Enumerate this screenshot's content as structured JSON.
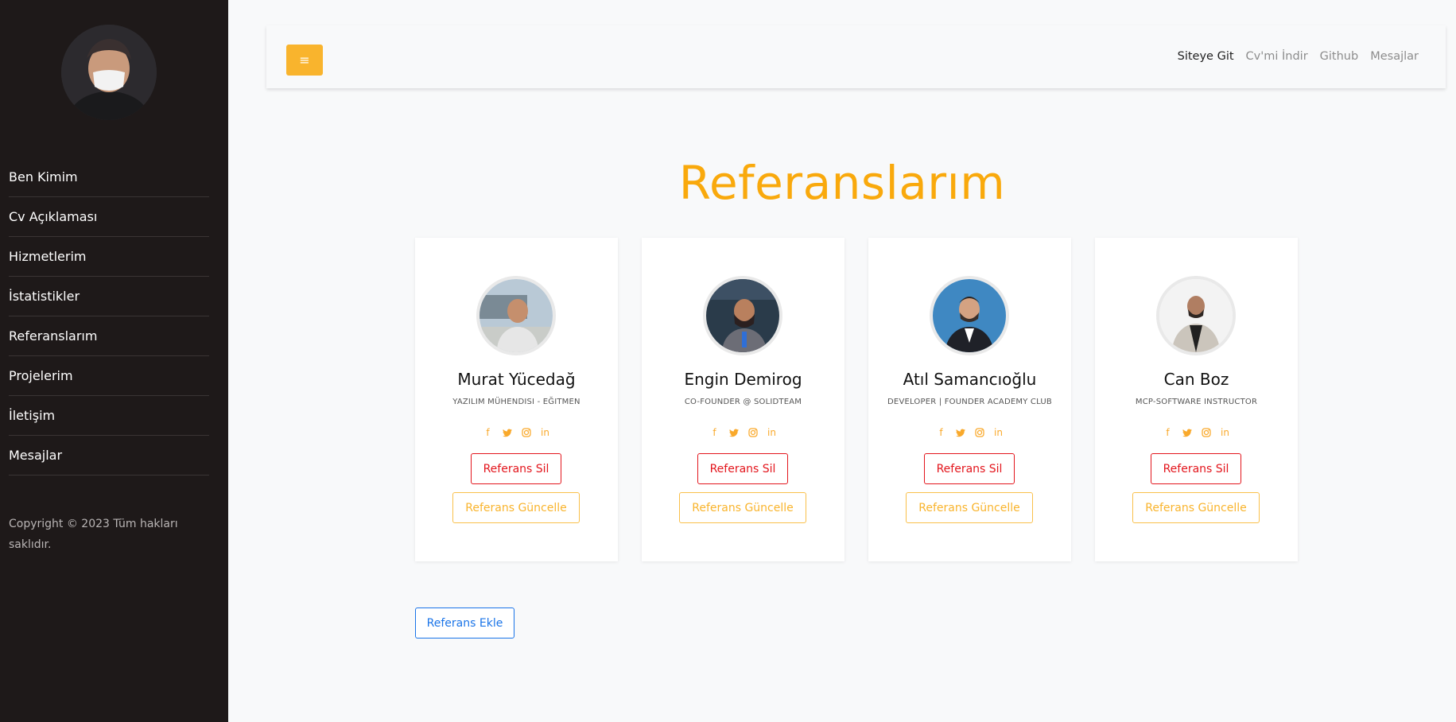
{
  "sidebar": {
    "items": [
      {
        "label": "Ben Kimim"
      },
      {
        "label": "Cv Açıklaması"
      },
      {
        "label": "Hizmetlerim"
      },
      {
        "label": "İstatistikler"
      },
      {
        "label": "Referanslarım"
      },
      {
        "label": "Projelerim"
      },
      {
        "label": "İletişim"
      },
      {
        "label": "Mesajlar"
      }
    ],
    "copyright": "Copyright © 2023 Tüm hakları saklıdır."
  },
  "topbar": {
    "menu_icon": "≡",
    "links": [
      {
        "label": "Siteye Git"
      },
      {
        "label": "Cv'mi İndir"
      },
      {
        "label": "Github"
      },
      {
        "label": "Mesajlar"
      }
    ]
  },
  "main": {
    "title": "Referanslarım",
    "cards": [
      {
        "name": "Murat Yücedağ",
        "role": "YAZILIM MÜHENDISI - EĞITMEN",
        "delete_label": "Referans Sil",
        "update_label": "Referans Güncelle"
      },
      {
        "name": "Engin Demirog",
        "role": "CO-FOUNDER @ SOLIDTEAM",
        "delete_label": "Referans Sil",
        "update_label": "Referans Güncelle"
      },
      {
        "name": "Atıl Samancıoğlu",
        "role": "DEVELOPER | FOUNDER ACADEMY CLUB",
        "delete_label": "Referans Sil",
        "update_label": "Referans Güncelle"
      },
      {
        "name": "Can Boz",
        "role": "MCP-SOFTWARE INSTRUCTOR",
        "delete_label": "Referans Sil",
        "update_label": "Referans Güncelle"
      }
    ],
    "social_icons": [
      "f",
      "t",
      "◎",
      "in"
    ],
    "add_label": "Referans Ekle"
  },
  "colors": {
    "sidebar_bg": "#1e1919",
    "accent": "#f9a90c",
    "danger": "#e3151c",
    "primary": "#1a74e8"
  }
}
